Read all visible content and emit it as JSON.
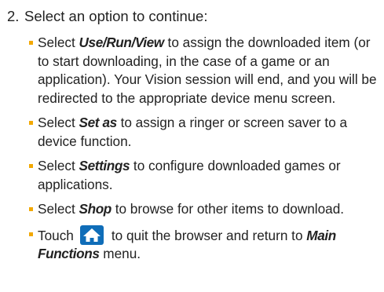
{
  "step": {
    "number": "2.",
    "text": "Select an option to continue:"
  },
  "bullets": [
    {
      "pre": "Select ",
      "term": "Use/Run/View",
      "post": " to assign the downloaded item (or to start downloading, in the case of a game or an application). Your Vision session will end, and you will be redirected to the appropriate device menu screen."
    },
    {
      "pre": "Select ",
      "term": "Set as",
      "post": " to assign a ringer or screen saver to a device function."
    },
    {
      "pre": "Select ",
      "term": "Settings",
      "post": " to configure downloaded games or applications."
    },
    {
      "pre": "Select ",
      "term": "Shop",
      "post": " to browse for other items to download."
    },
    {
      "pre": "Touch",
      "icon": "home-icon",
      "post": "to quit the browser and return to ",
      "term": "Main Functions",
      "tail": " menu."
    }
  ],
  "colors": {
    "bullet": "#f2a800",
    "icon_bg": "#0f6db8",
    "text": "#222222"
  }
}
